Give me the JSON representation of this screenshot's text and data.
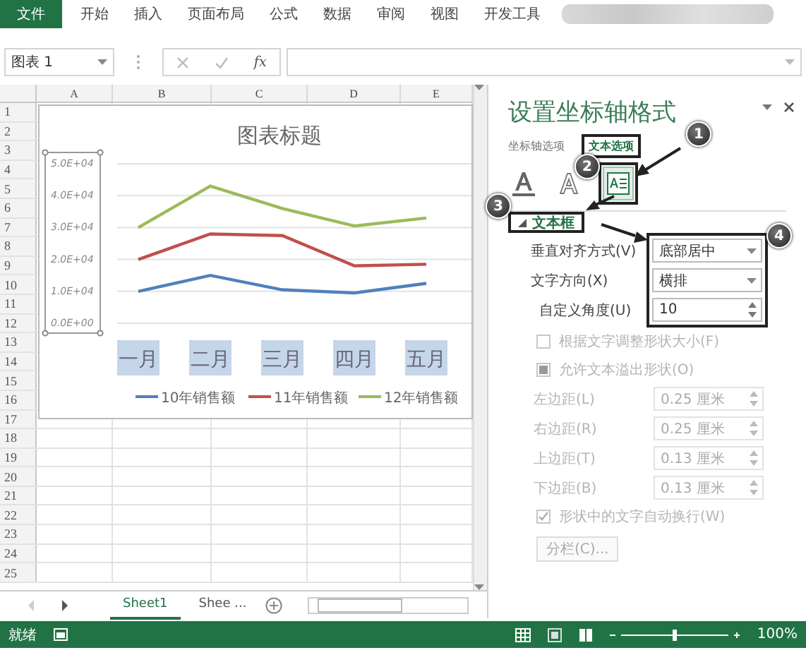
{
  "ribbon_tabs": [
    {
      "label": "文件",
      "kind": "file"
    },
    {
      "label": "开始",
      "kind": "tab"
    },
    {
      "label": "插入",
      "kind": "tab"
    },
    {
      "label": "页面布局",
      "kind": "tab"
    },
    {
      "label": "公式",
      "kind": "tab"
    },
    {
      "label": "数据",
      "kind": "tab"
    },
    {
      "label": "审阅",
      "kind": "tab"
    },
    {
      "label": "视图",
      "kind": "tab"
    },
    {
      "label": "开发工具",
      "kind": "tab"
    }
  ],
  "name_box": "图表 1",
  "function_label": "fx",
  "columns": [
    "A",
    "B",
    "C",
    "D",
    "E"
  ],
  "rows": [
    "1",
    "2",
    "3",
    "4",
    "5",
    "6",
    "7",
    "8",
    "9",
    "10",
    "11",
    "12",
    "13",
    "14",
    "15",
    "16",
    "17",
    "18",
    "19",
    "20",
    "21",
    "22",
    "23",
    "24",
    "25"
  ],
  "chart": {
    "axis_selected": true,
    "categories_selected": true,
    "chart_data": {
      "type": "line",
      "title": "图表标题",
      "grid": true,
      "legend": true,
      "categories": [
        "一月",
        "二月",
        "三月",
        "四月",
        "五月"
      ],
      "series": [
        {
          "name": "10年销售额",
          "color": "#4f81bd",
          "values": [
            10000,
            15000,
            10500,
            9500,
            12500
          ]
        },
        {
          "name": "11年销售额",
          "color": "#c0504d",
          "values": [
            20000,
            28000,
            27500,
            18000,
            18500
          ]
        },
        {
          "name": "12年销售额",
          "color": "#9bbb59",
          "values": [
            30000,
            43000,
            36000,
            30500,
            33000
          ]
        }
      ],
      "ylim": [
        0,
        50000
      ],
      "yticks": [
        {
          "value": 0,
          "label": "0.0E+00"
        },
        {
          "value": 10000,
          "label": "1.0E+04"
        },
        {
          "value": 20000,
          "label": "2.0E+04"
        },
        {
          "value": 30000,
          "label": "3.0E+04"
        },
        {
          "value": 40000,
          "label": "4.0E+04"
        },
        {
          "value": 50000,
          "label": "5.0E+04"
        }
      ]
    }
  },
  "sheet_tabs": [
    {
      "label": "Sheet1",
      "selected": true
    },
    {
      "label": "Shee ...",
      "selected": false
    }
  ],
  "status": "就绪",
  "zoom_slider": {
    "level": 0.5
  },
  "zoom": "100%",
  "pane": {
    "title": "设置坐标轴格式",
    "option_tabs": [
      {
        "label": "坐标轴选项",
        "selected": false
      },
      {
        "label": "文本选项",
        "selected": true
      }
    ],
    "icon_tabs": [
      {
        "kind": "fill",
        "selected": false
      },
      {
        "kind": "outline",
        "selected": false
      },
      {
        "kind": "textbox",
        "selected": true
      }
    ],
    "section": {
      "label": "文本框",
      "expanded": true
    },
    "alignment": [
      {
        "kind": "dropdown",
        "label": "垂直对齐方式(V)",
        "value": "底部居中"
      },
      {
        "kind": "dropdown",
        "label": "文字方向(X)",
        "value": "横排"
      },
      {
        "kind": "spin",
        "label": "自定义角度(U)",
        "value": "10"
      }
    ],
    "settings": [
      {
        "kind": "checkbox",
        "label": "根据文字调整形状大小(F)",
        "checked": false,
        "disabled": true
      },
      {
        "kind": "checkbox",
        "label": "允许文本溢出形状(O)",
        "checked": true,
        "disabled": true
      },
      {
        "kind": "spin",
        "label": "左边距(L)",
        "value": "0.25 厘米",
        "disabled": true
      },
      {
        "kind": "spin",
        "label": "右边距(R)",
        "value": "0.25 厘米",
        "disabled": true
      },
      {
        "kind": "spin",
        "label": "上边距(T)",
        "value": "0.13 厘米",
        "disabled": true
      },
      {
        "kind": "spin",
        "label": "下边距(B)",
        "value": "0.13 厘米",
        "disabled": true
      },
      {
        "kind": "checkbox",
        "label": "形状中的文字自动换行(W)",
        "checked": true,
        "disabled": true
      },
      {
        "kind": "button",
        "label": "分栏(C)...",
        "disabled": true
      }
    ]
  },
  "callouts": [
    "1",
    "2",
    "3",
    "4"
  ]
}
